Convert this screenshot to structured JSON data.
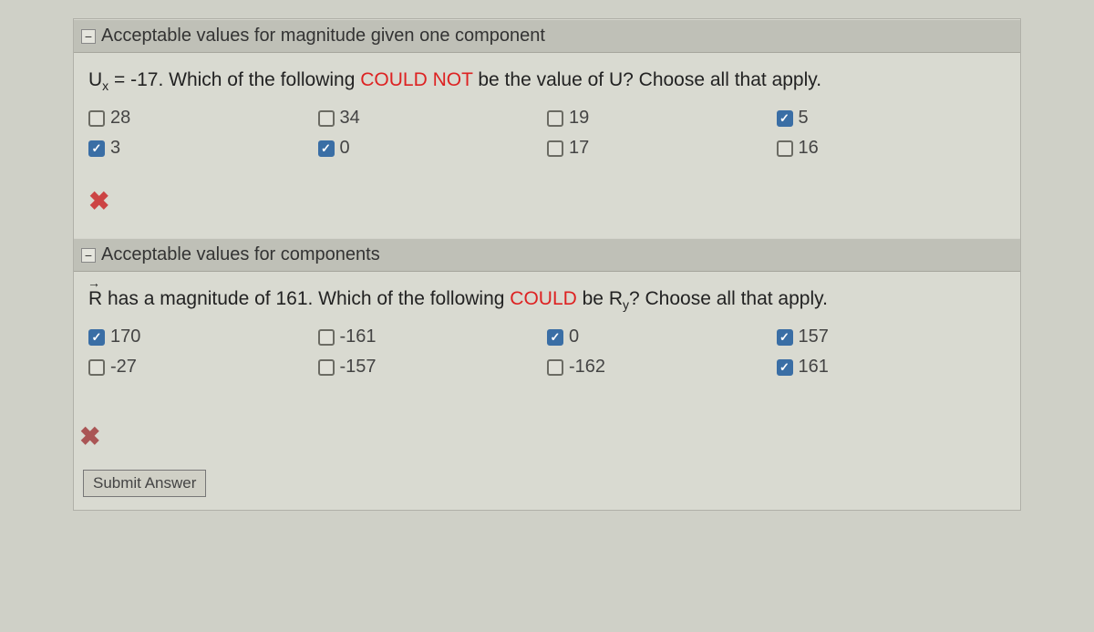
{
  "section1": {
    "title": "Acceptable values for magnitude given one component",
    "question_pre": "U",
    "question_sub": "x",
    "question_mid": " = -17. Which of the following ",
    "question_red": "COULD NOT",
    "question_post": " be the value of U? Choose all that apply.",
    "options": [
      {
        "label": "28",
        "checked": false
      },
      {
        "label": "34",
        "checked": false
      },
      {
        "label": "19",
        "checked": false
      },
      {
        "label": "5",
        "checked": true
      },
      {
        "label": "3",
        "checked": true
      },
      {
        "label": "0",
        "checked": true
      },
      {
        "label": "17",
        "checked": false
      },
      {
        "label": "16",
        "checked": false
      }
    ],
    "result_icon": "✖"
  },
  "section2": {
    "title": "Acceptable values for components",
    "question_vec": "R",
    "question_mid": " has a magnitude of 161. Which of the following ",
    "question_red": "COULD",
    "question_post1": " be R",
    "question_sub": "y",
    "question_post2": "? Choose all that apply.",
    "options": [
      {
        "label": "170",
        "checked": true
      },
      {
        "label": "-161",
        "checked": false
      },
      {
        "label": "0",
        "checked": true
      },
      {
        "label": "157",
        "checked": true
      },
      {
        "label": "-27",
        "checked": false
      },
      {
        "label": "-157",
        "checked": false
      },
      {
        "label": "-162",
        "checked": false
      },
      {
        "label": "161",
        "checked": true
      }
    ],
    "result_icon": "✖"
  },
  "submit_label": "Submit Answer"
}
